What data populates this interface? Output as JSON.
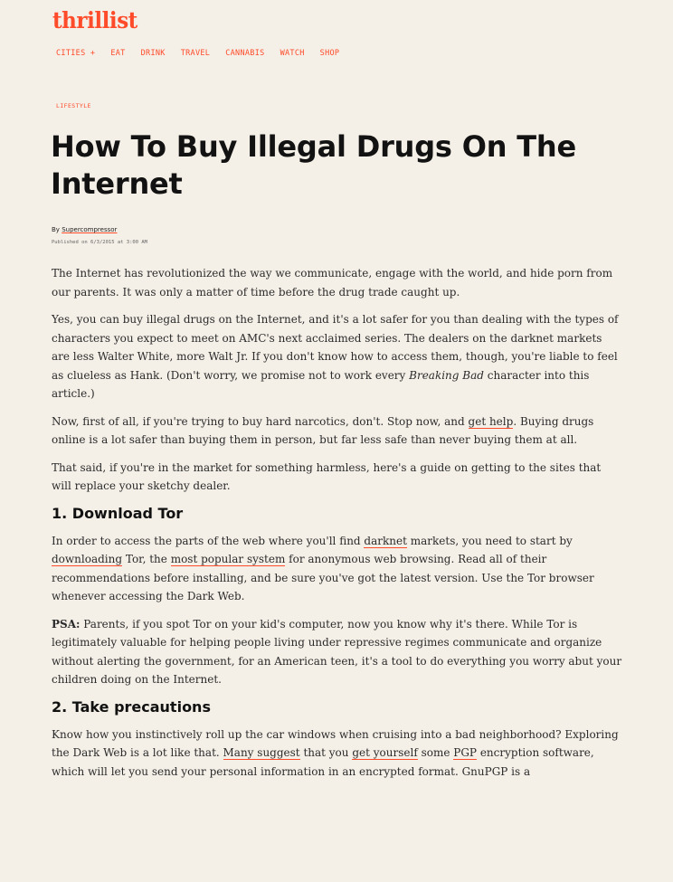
{
  "site": {
    "logo": "thrillist",
    "nav": [
      "CITIES +",
      "EAT",
      "DRINK",
      "TRAVEL",
      "CANNABIS",
      "WATCH",
      "SHOP"
    ]
  },
  "article": {
    "category": "LIFESTYLE",
    "title": "How To Buy Illegal Drugs On The Internet",
    "by_prefix": "By",
    "author": "Supercompressor",
    "published": "Published on 6/3/2015 at 3:00 AM",
    "p1": "The Internet has revolutionized the way we communicate, engage with the world, and hide porn from our parents. It was only a matter of time before the drug trade caught up.",
    "p2_text": "Yes, you can buy illegal drugs on the Internet, and it's a lot safer for you than dealing with the types of characters you expect to meet on AMC's next acclaimed series. The dealers on the darknet markets are less Walter White, more Walt Jr. If you don't know how to access them, though, you're liable to feel as clueless as Hank. (Don't worry, we promise not to work every ",
    "p2_em": "Breaking Bad",
    "p2_end": " character into this article.)",
    "p3_a": "Now, first of all, if you're trying to buy hard narcotics, don't. Stop now, and ",
    "p3_link": "get help",
    "p3_b": ". Buying drugs online is a lot safer than buying them in person, but far less safe than never buying them at all.",
    "p4": "That said, if you're in the market for something harmless, here's a guide on getting to the sites that will replace your sketchy dealer.",
    "h1": "1. Download Tor",
    "p5_a": "In order to access the parts of the web where you'll find ",
    "p5_link1": "darknet",
    "p5_b": " markets, you need to start by ",
    "p5_link2": "downloading",
    "p5_c": " Tor, the ",
    "p5_link3": "most popular system",
    "p5_d": " for anonymous web browsing. Read all of their recommendations before installing, and be sure you've got the latest version. Use the Tor browser whenever accessing the Dark Web.",
    "p6_strong": "PSA:",
    "p6": " Parents, if you spot Tor on your kid's computer, now you know why it's there. While Tor is legitimately valuable for helping people living under repressive regimes communicate and organize without alerting the government, for an American teen, it's a tool to do everything you worry abut your children doing on the Internet.",
    "h2": "2. Take precautions",
    "p7_a": "Know how you instinctively roll up the car windows when cruising into a bad neighborhood? Exploring the Dark Web is a lot like that. ",
    "p7_link1": "Many suggest",
    "p7_b": " that you ",
    "p7_link2": "get yourself",
    "p7_c": " some ",
    "p7_link3": "PGP",
    "p7_d": " encryption software, which will let you send your personal information in an encrypted format. GnuPGP is a"
  }
}
